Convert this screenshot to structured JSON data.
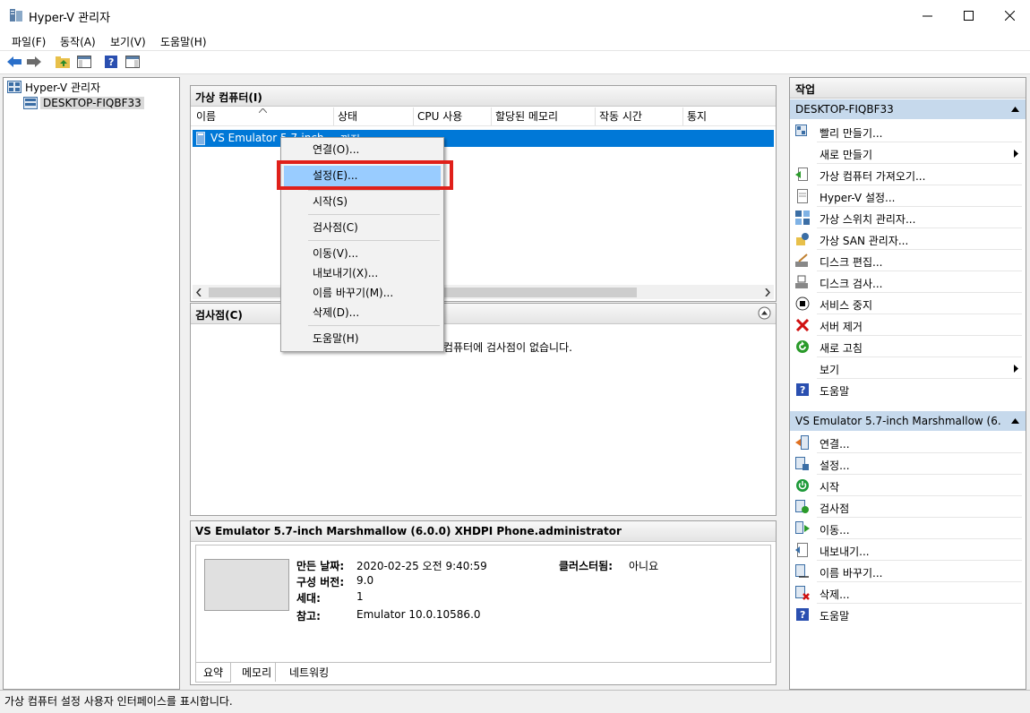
{
  "window": {
    "title": "Hyper-V 관리자"
  },
  "menubar": [
    "파일(F)",
    "동작(A)",
    "보기(V)",
    "도움말(H)"
  ],
  "tree": {
    "root": "Hyper-V 관리자",
    "host": "DESKTOP-FIQBF33"
  },
  "vm_panel": {
    "title": "가상 컴퓨터(I)",
    "columns": [
      "이름",
      "상태",
      "CPU 사용",
      "할당된 메모리",
      "작동 시간",
      "통지"
    ],
    "row": {
      "name": "VS Emulator 5.7-inch",
      "state": "꺼짐"
    }
  },
  "context_menu": {
    "items": [
      "연결(O)...",
      "설정(E)...",
      "시작(S)",
      "검사점(C)",
      "이동(V)...",
      "내보내기(X)...",
      "이름 바꾸기(M)...",
      "삭제(D)...",
      "도움말(H)"
    ],
    "highlighted": "설정(E)..."
  },
  "checkpoint_panel": {
    "title": "검사점(C)",
    "empty_text": "컴퓨터에 검사점이 없습니다."
  },
  "details": {
    "title": "VS Emulator 5.7-inch Marshmallow (6.0.0) XHDPI Phone.administrator",
    "created_label": "만든 날짜:",
    "created_value": "2020-02-25 오전 9:40:59",
    "config_label": "구성 버전:",
    "config_value": "9.0",
    "gen_label": "세대:",
    "gen_value": "1",
    "notes_label": "참고:",
    "notes_value": "Emulator 10.0.10586.0",
    "cluster_label": "클러스터됨:",
    "cluster_value": "아니요",
    "tabs": [
      "요약",
      "메모리",
      "네트워킹"
    ]
  },
  "actions": {
    "title": "작업",
    "host_section": "DESKTOP-FIQBF33",
    "host_items": [
      "빨리 만들기...",
      "새로 만들기",
      "가상 컴퓨터 가져오기...",
      "Hyper-V 설정...",
      "가상 스위치 관리자...",
      "가상 SAN 관리자...",
      "디스크 편집...",
      "디스크 검사...",
      "서비스 중지",
      "서버 제거",
      "새로 고침",
      "보기",
      "도움말"
    ],
    "vm_section": "VS Emulator 5.7-inch Marshmallow (6.0....",
    "vm_items": [
      "연결...",
      "설정...",
      "시작",
      "검사점",
      "이동...",
      "내보내기...",
      "이름 바꾸기...",
      "삭제...",
      "도움말"
    ]
  },
  "status": "가상 컴퓨터 설정 사용자 인터페이스를 표시합니다.",
  "colors": {
    "selection": "#0078d7",
    "menu_highlight": "#99ccff",
    "red_box": "#e0201a",
    "action_header": "#c6d9ec"
  }
}
